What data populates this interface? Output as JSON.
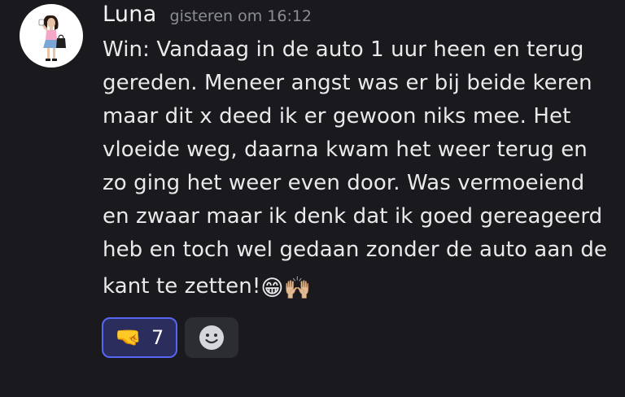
{
  "message": {
    "username": "Luna",
    "timestamp": "gisteren om 16:12",
    "lines": [
      "Win: Vandaag in de auto 1 uur heen en terug",
      "gereden. Meneer angst was er bij beide keren",
      "maar dit x deed ik er gewoon niks mee. Het",
      "vloeide weg, daarna kwam het weer terug en",
      "zo ging het weer even door. Was vermoeiend",
      "en zwaar maar ik denk dat ik goed gereageerd",
      "heb en toch wel gedaan zonder de auto aan de",
      "kant te zetten!"
    ],
    "trailing_emojis": [
      "😁",
      "🙌🏼"
    ]
  },
  "reactions": [
    {
      "emoji": "🤜",
      "count": "7",
      "active": true
    }
  ],
  "add_reaction": {
    "icon": "smiley-add-icon"
  },
  "colors": {
    "background": "#1a1a1e",
    "accent": "#5865f2",
    "reaction_active_bg": "#2b2e5c",
    "text": "#e8e9eb",
    "muted": "#8a8d94"
  }
}
